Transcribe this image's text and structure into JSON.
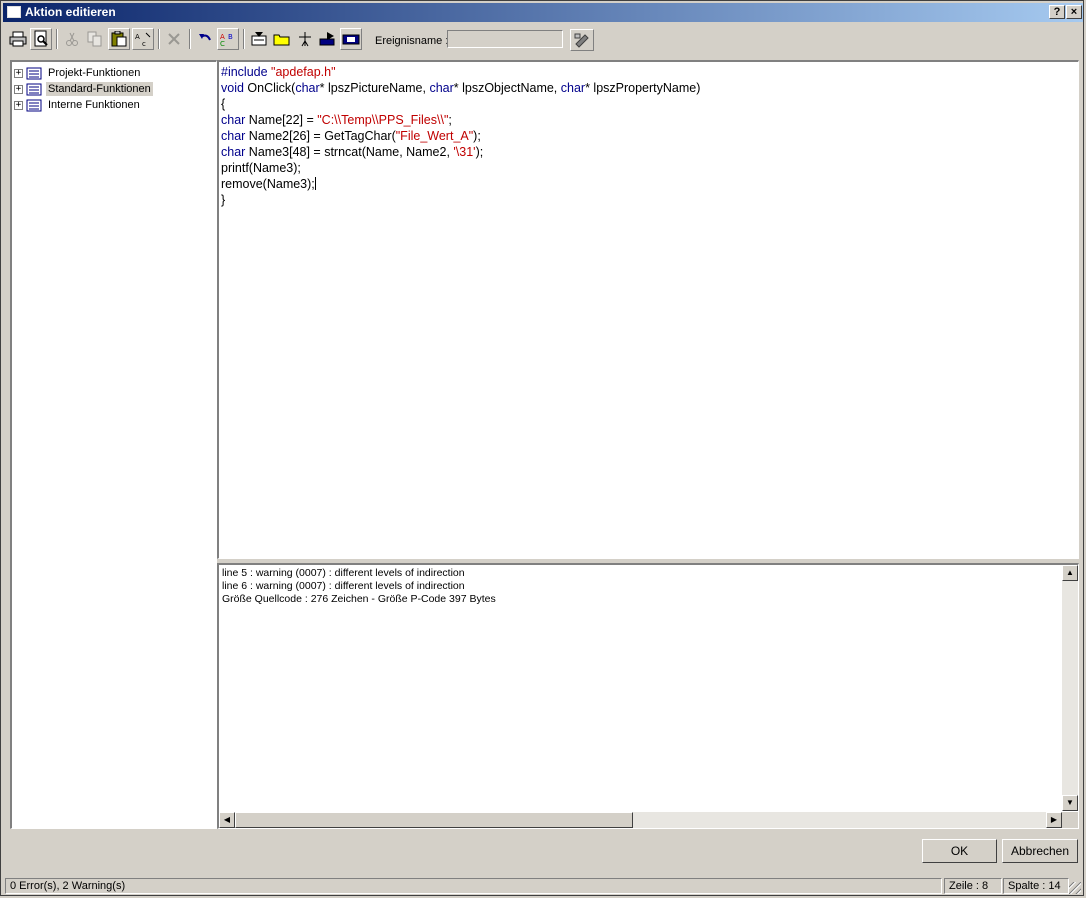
{
  "window": {
    "title": "Aktion editieren",
    "help_label": "?",
    "close_label": "×"
  },
  "toolbar": {
    "buttons": [
      "print-icon",
      "print-preview-icon",
      "cut-icon",
      "copy-icon",
      "paste-icon",
      "replace-icon",
      "delete-icon",
      "undo-icon",
      "spell-icon",
      "import-icon",
      "open-icon",
      "compile-icon",
      "export-icon",
      "info-icon"
    ],
    "event_label": "Ereignisname :",
    "event_value": ""
  },
  "tree": {
    "items": [
      {
        "label": "Projekt-Funktionen",
        "expander": "+"
      },
      {
        "label": "Standard-Funktionen",
        "expander": "+"
      },
      {
        "label": "Interne Funktionen",
        "expander": "+"
      }
    ]
  },
  "editor": {
    "lines": [
      [
        [
          "#include ",
          "kw"
        ],
        [
          "\"apdefap.h\"",
          "str"
        ]
      ],
      [
        [
          "void",
          "kw"
        ],
        [
          " OnClick(",
          ""
        ],
        [
          "char",
          "kw"
        ],
        [
          "* lpszPictureName, ",
          ""
        ],
        [
          "char",
          "kw"
        ],
        [
          "* lpszObjectName, ",
          ""
        ],
        [
          "char",
          "kw"
        ],
        [
          "* lpszPropertyName)",
          ""
        ]
      ],
      [
        [
          "{",
          ""
        ]
      ],
      [
        [
          "char",
          "kw"
        ],
        [
          " Name[22] = ",
          ""
        ],
        [
          "\"C:\\\\Temp\\\\PPS_Files\\\\\"",
          "str"
        ],
        [
          ";",
          ""
        ]
      ],
      [
        [
          "char",
          "kw"
        ],
        [
          " Name2[26] = GetTagChar(",
          ""
        ],
        [
          "\"File_Wert_A\"",
          "str"
        ],
        [
          ");",
          ""
        ]
      ],
      [
        [
          "char",
          "kw"
        ],
        [
          " Name3[48] = strncat(Name, Name2, ",
          ""
        ],
        [
          "'\\31'",
          "str"
        ],
        [
          ");",
          ""
        ]
      ],
      [
        [
          "printf(Name3);",
          ""
        ]
      ],
      [
        [
          "remove(Name3);",
          ""
        ]
      ],
      [
        [
          "}",
          ""
        ]
      ]
    ]
  },
  "output": {
    "lines": [
      "line 5 : warning (0007) : different levels of indirection",
      "line 6 : warning (0007) : different levels of indirection",
      "Größe Quellcode : 276 Zeichen  -  Größe P-Code 397 Bytes"
    ]
  },
  "buttons": {
    "ok": "OK",
    "cancel": "Abbrechen"
  },
  "status": {
    "messages": "0 Error(s), 2 Warning(s)",
    "line": "Zeile : 8",
    "column": "Spalte : 14"
  }
}
